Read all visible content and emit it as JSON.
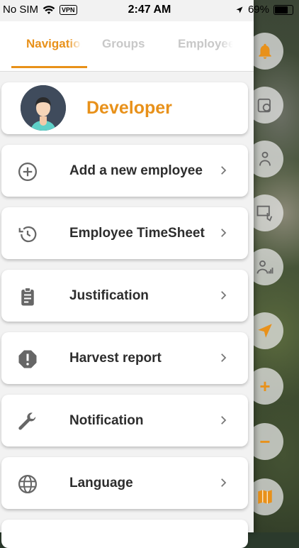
{
  "status_bar": {
    "carrier": "No SIM",
    "vpn": "VPN",
    "time": "2:47 AM",
    "battery": "69%",
    "battery_level": 0.69
  },
  "tabs": [
    {
      "label": "Navigation",
      "active": true
    },
    {
      "label": "Groups",
      "active": false
    },
    {
      "label": "Employees",
      "active": false
    }
  ],
  "profile": {
    "name": "Developer"
  },
  "menu": [
    {
      "label": "Add a new employee",
      "icon": "add-circle-icon"
    },
    {
      "label": "Employee TimeSheet",
      "icon": "history-icon"
    },
    {
      "label": "Justification",
      "icon": "clipboard-icon"
    },
    {
      "label": "Harvest report",
      "icon": "alert-octagon-icon"
    },
    {
      "label": "Notification",
      "icon": "wrench-icon"
    },
    {
      "label": "Language",
      "icon": "globe-icon"
    }
  ],
  "map_buttons": [
    "bell-icon",
    "timesheet-icon",
    "worker-icon",
    "touch-map-icon",
    "group-chart-icon",
    "locate-arrow-icon",
    "zoom-in-icon",
    "zoom-out-icon",
    "map-layers-icon"
  ],
  "colors": {
    "accent": "#e8911a",
    "text": "#2d2d2d",
    "icon": "#666666"
  }
}
